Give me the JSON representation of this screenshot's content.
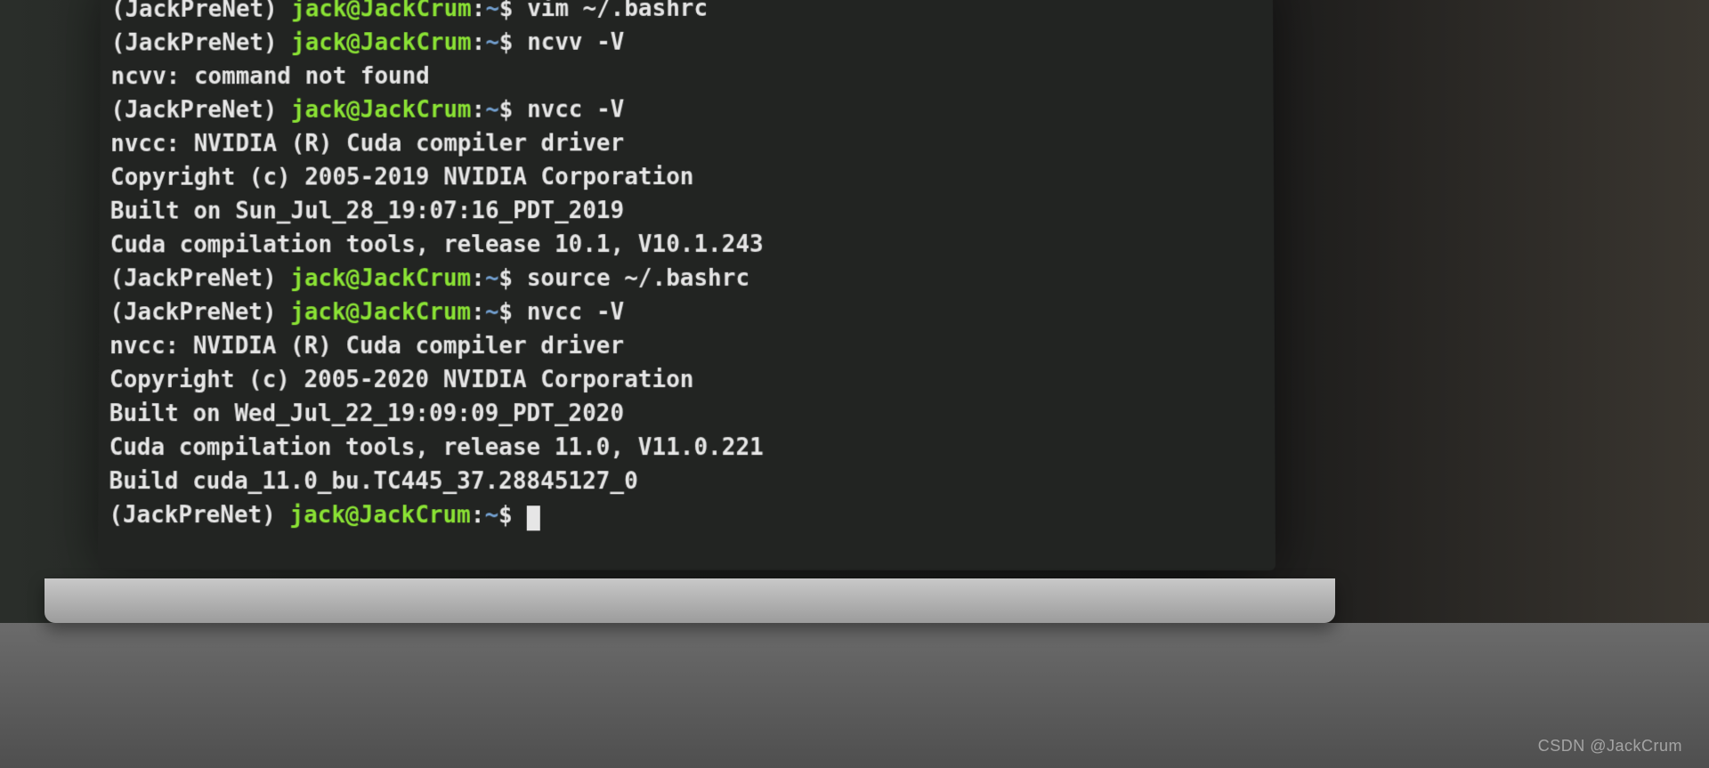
{
  "prompt": {
    "env_prefix": "(JackPreNet) ",
    "user_host": "jack@JackCrum",
    "sep": ":",
    "cwd": "~",
    "sigil": "$ "
  },
  "lines": [
    {
      "kind": "prompt",
      "cmd": "vim ~/.bashrc"
    },
    {
      "kind": "prompt",
      "cmd": "ncvv -V"
    },
    {
      "kind": "out",
      "text": "ncvv: command not found"
    },
    {
      "kind": "prompt",
      "cmd": "nvcc -V"
    },
    {
      "kind": "out",
      "text": "nvcc: NVIDIA (R) Cuda compiler driver"
    },
    {
      "kind": "out",
      "text": "Copyright (c) 2005-2019 NVIDIA Corporation"
    },
    {
      "kind": "out",
      "text": "Built on Sun_Jul_28_19:07:16_PDT_2019"
    },
    {
      "kind": "out",
      "text": "Cuda compilation tools, release 10.1, V10.1.243"
    },
    {
      "kind": "prompt",
      "cmd": "source ~/.bashrc"
    },
    {
      "kind": "prompt",
      "cmd": "nvcc -V"
    },
    {
      "kind": "out",
      "text": "nvcc: NVIDIA (R) Cuda compiler driver"
    },
    {
      "kind": "out",
      "text": "Copyright (c) 2005-2020 NVIDIA Corporation"
    },
    {
      "kind": "out",
      "text": "Built on Wed_Jul_22_19:09:09_PDT_2020"
    },
    {
      "kind": "out",
      "text": "Cuda compilation tools, release 11.0, V11.0.221"
    },
    {
      "kind": "out",
      "text": "Build cuda_11.0_bu.TC445_37.28845127_0"
    },
    {
      "kind": "prompt",
      "cmd": "",
      "cursor": true
    }
  ],
  "watermark": "CSDN @JackCrum"
}
